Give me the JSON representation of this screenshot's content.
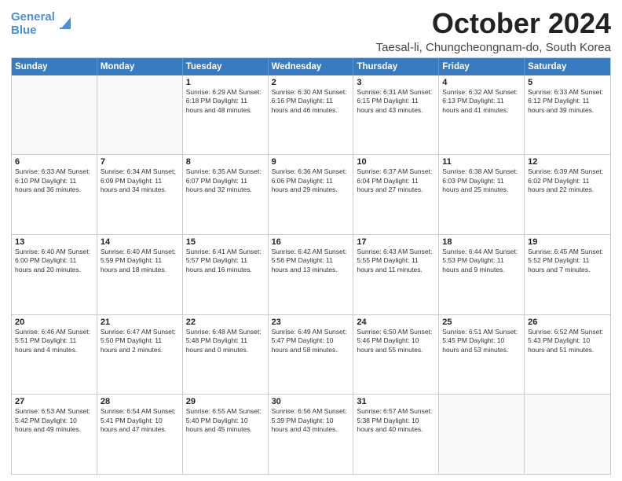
{
  "logo": {
    "line1": "General",
    "line2": "Blue"
  },
  "title": "October 2024",
  "subtitle": "Taesal-li, Chungcheongnam-do, South Korea",
  "header_days": [
    "Sunday",
    "Monday",
    "Tuesday",
    "Wednesday",
    "Thursday",
    "Friday",
    "Saturday"
  ],
  "weeks": [
    [
      {
        "day": "",
        "info": ""
      },
      {
        "day": "",
        "info": ""
      },
      {
        "day": "1",
        "info": "Sunrise: 6:29 AM\nSunset: 6:18 PM\nDaylight: 11 hours and 48 minutes."
      },
      {
        "day": "2",
        "info": "Sunrise: 6:30 AM\nSunset: 6:16 PM\nDaylight: 11 hours and 46 minutes."
      },
      {
        "day": "3",
        "info": "Sunrise: 6:31 AM\nSunset: 6:15 PM\nDaylight: 11 hours and 43 minutes."
      },
      {
        "day": "4",
        "info": "Sunrise: 6:32 AM\nSunset: 6:13 PM\nDaylight: 11 hours and 41 minutes."
      },
      {
        "day": "5",
        "info": "Sunrise: 6:33 AM\nSunset: 6:12 PM\nDaylight: 11 hours and 39 minutes."
      }
    ],
    [
      {
        "day": "6",
        "info": "Sunrise: 6:33 AM\nSunset: 6:10 PM\nDaylight: 11 hours and 36 minutes."
      },
      {
        "day": "7",
        "info": "Sunrise: 6:34 AM\nSunset: 6:09 PM\nDaylight: 11 hours and 34 minutes."
      },
      {
        "day": "8",
        "info": "Sunrise: 6:35 AM\nSunset: 6:07 PM\nDaylight: 11 hours and 32 minutes."
      },
      {
        "day": "9",
        "info": "Sunrise: 6:36 AM\nSunset: 6:06 PM\nDaylight: 11 hours and 29 minutes."
      },
      {
        "day": "10",
        "info": "Sunrise: 6:37 AM\nSunset: 6:04 PM\nDaylight: 11 hours and 27 minutes."
      },
      {
        "day": "11",
        "info": "Sunrise: 6:38 AM\nSunset: 6:03 PM\nDaylight: 11 hours and 25 minutes."
      },
      {
        "day": "12",
        "info": "Sunrise: 6:39 AM\nSunset: 6:02 PM\nDaylight: 11 hours and 22 minutes."
      }
    ],
    [
      {
        "day": "13",
        "info": "Sunrise: 6:40 AM\nSunset: 6:00 PM\nDaylight: 11 hours and 20 minutes."
      },
      {
        "day": "14",
        "info": "Sunrise: 6:40 AM\nSunset: 5:59 PM\nDaylight: 11 hours and 18 minutes."
      },
      {
        "day": "15",
        "info": "Sunrise: 6:41 AM\nSunset: 5:57 PM\nDaylight: 11 hours and 16 minutes."
      },
      {
        "day": "16",
        "info": "Sunrise: 6:42 AM\nSunset: 5:56 PM\nDaylight: 11 hours and 13 minutes."
      },
      {
        "day": "17",
        "info": "Sunrise: 6:43 AM\nSunset: 5:55 PM\nDaylight: 11 hours and 11 minutes."
      },
      {
        "day": "18",
        "info": "Sunrise: 6:44 AM\nSunset: 5:53 PM\nDaylight: 11 hours and 9 minutes."
      },
      {
        "day": "19",
        "info": "Sunrise: 6:45 AM\nSunset: 5:52 PM\nDaylight: 11 hours and 7 minutes."
      }
    ],
    [
      {
        "day": "20",
        "info": "Sunrise: 6:46 AM\nSunset: 5:51 PM\nDaylight: 11 hours and 4 minutes."
      },
      {
        "day": "21",
        "info": "Sunrise: 6:47 AM\nSunset: 5:50 PM\nDaylight: 11 hours and 2 minutes."
      },
      {
        "day": "22",
        "info": "Sunrise: 6:48 AM\nSunset: 5:48 PM\nDaylight: 11 hours and 0 minutes."
      },
      {
        "day": "23",
        "info": "Sunrise: 6:49 AM\nSunset: 5:47 PM\nDaylight: 10 hours and 58 minutes."
      },
      {
        "day": "24",
        "info": "Sunrise: 6:50 AM\nSunset: 5:46 PM\nDaylight: 10 hours and 55 minutes."
      },
      {
        "day": "25",
        "info": "Sunrise: 6:51 AM\nSunset: 5:45 PM\nDaylight: 10 hours and 53 minutes."
      },
      {
        "day": "26",
        "info": "Sunrise: 6:52 AM\nSunset: 5:43 PM\nDaylight: 10 hours and 51 minutes."
      }
    ],
    [
      {
        "day": "27",
        "info": "Sunrise: 6:53 AM\nSunset: 5:42 PM\nDaylight: 10 hours and 49 minutes."
      },
      {
        "day": "28",
        "info": "Sunrise: 6:54 AM\nSunset: 5:41 PM\nDaylight: 10 hours and 47 minutes."
      },
      {
        "day": "29",
        "info": "Sunrise: 6:55 AM\nSunset: 5:40 PM\nDaylight: 10 hours and 45 minutes."
      },
      {
        "day": "30",
        "info": "Sunrise: 6:56 AM\nSunset: 5:39 PM\nDaylight: 10 hours and 43 minutes."
      },
      {
        "day": "31",
        "info": "Sunrise: 6:57 AM\nSunset: 5:38 PM\nDaylight: 10 hours and 40 minutes."
      },
      {
        "day": "",
        "info": ""
      },
      {
        "day": "",
        "info": ""
      }
    ]
  ]
}
